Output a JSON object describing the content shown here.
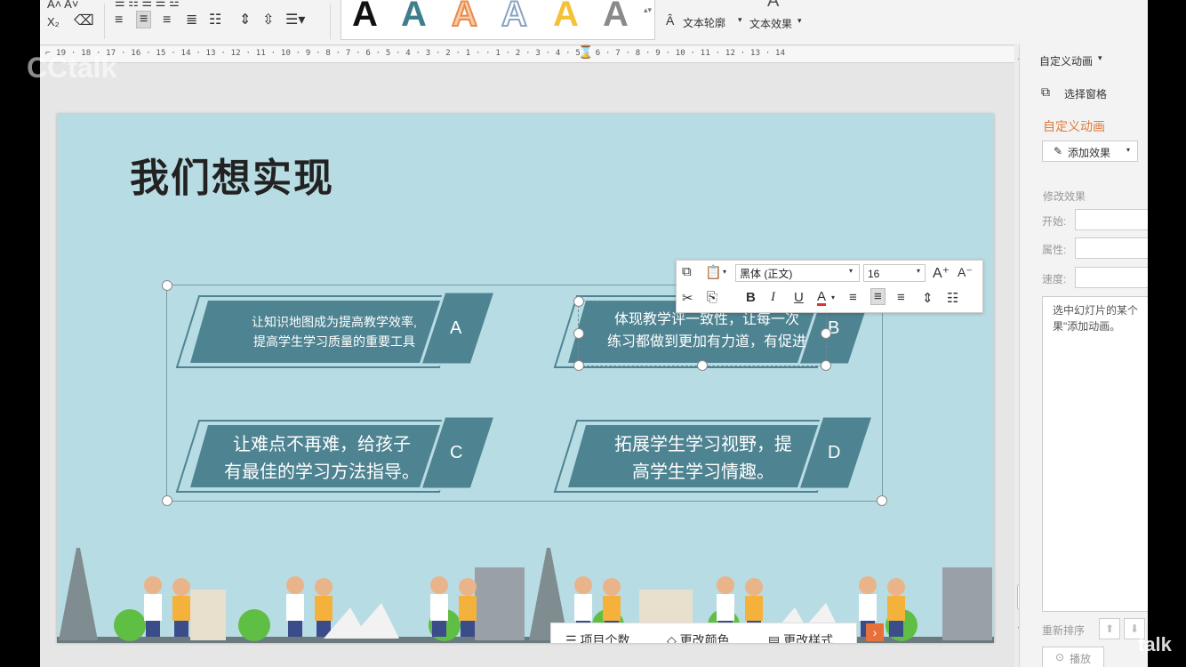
{
  "ribbon": {
    "text_outline": "文本轮廓",
    "text_effect": "文本效果",
    "gallery_letters": [
      "A",
      "A",
      "A",
      "A",
      "A",
      "A"
    ]
  },
  "ruler": {
    "numbers": "19 · 18 · 17 · 16 · 15 · 14 · 13 · 12 · 11 · 10 · 9 · 8 · 7 · 6 · 5 · 4 · 3 · 2 · 1 · · 1 · 2 · 3 · 4 · 5 · 6 · 7 · 8 · 9 · 10 · 11 · 12 · 13 · 14"
  },
  "slide": {
    "title": "我们想实现",
    "cards": [
      {
        "line1": "让知识地图成为提高教学效率,",
        "line2": "提高学生学习质量的重要工具",
        "letter": "A"
      },
      {
        "line1": "体现教学评一致性，让每一次",
        "line2": "练习都做到更加有力道，有促进",
        "letter": "B"
      },
      {
        "line1": "让难点不再难，给孩子",
        "line2": "有最佳的学习方法指导。",
        "letter": "C"
      },
      {
        "line1": "拓展学生学习视野，提",
        "line2": "高学生学习情趣。",
        "letter": "D"
      }
    ]
  },
  "floatbar": {
    "font_name": "黑体 (正文)",
    "font_size": "16",
    "grow": "A⁺",
    "shrink": "A⁻",
    "bold": "B",
    "italic": "I",
    "underline": "U",
    "font_color": "A"
  },
  "smartbar": {
    "item_count": "项目个数",
    "change_color": "更改颜色",
    "change_style": "更改样式",
    "arrow": "›"
  },
  "pane": {
    "header": "自定义动画",
    "select_pane": "选择窗格",
    "section_title": "自定义动画",
    "add_effect": "添加效果",
    "modify_effect": "修改效果",
    "start_label": "开始:",
    "property_label": "属性:",
    "speed_label": "速度:",
    "hint_line1": "选中幻灯片的某个",
    "hint_line2": "果\"添加动画。",
    "reorder_label": "重新排序",
    "play_label": "播放"
  },
  "watermark": {
    "text": "CCtalk",
    "corner": "talk"
  },
  "colors": {
    "slide_bg": "#b8dce3",
    "card_fill": "#4e8392",
    "pane_accent": "#e07a3a"
  }
}
